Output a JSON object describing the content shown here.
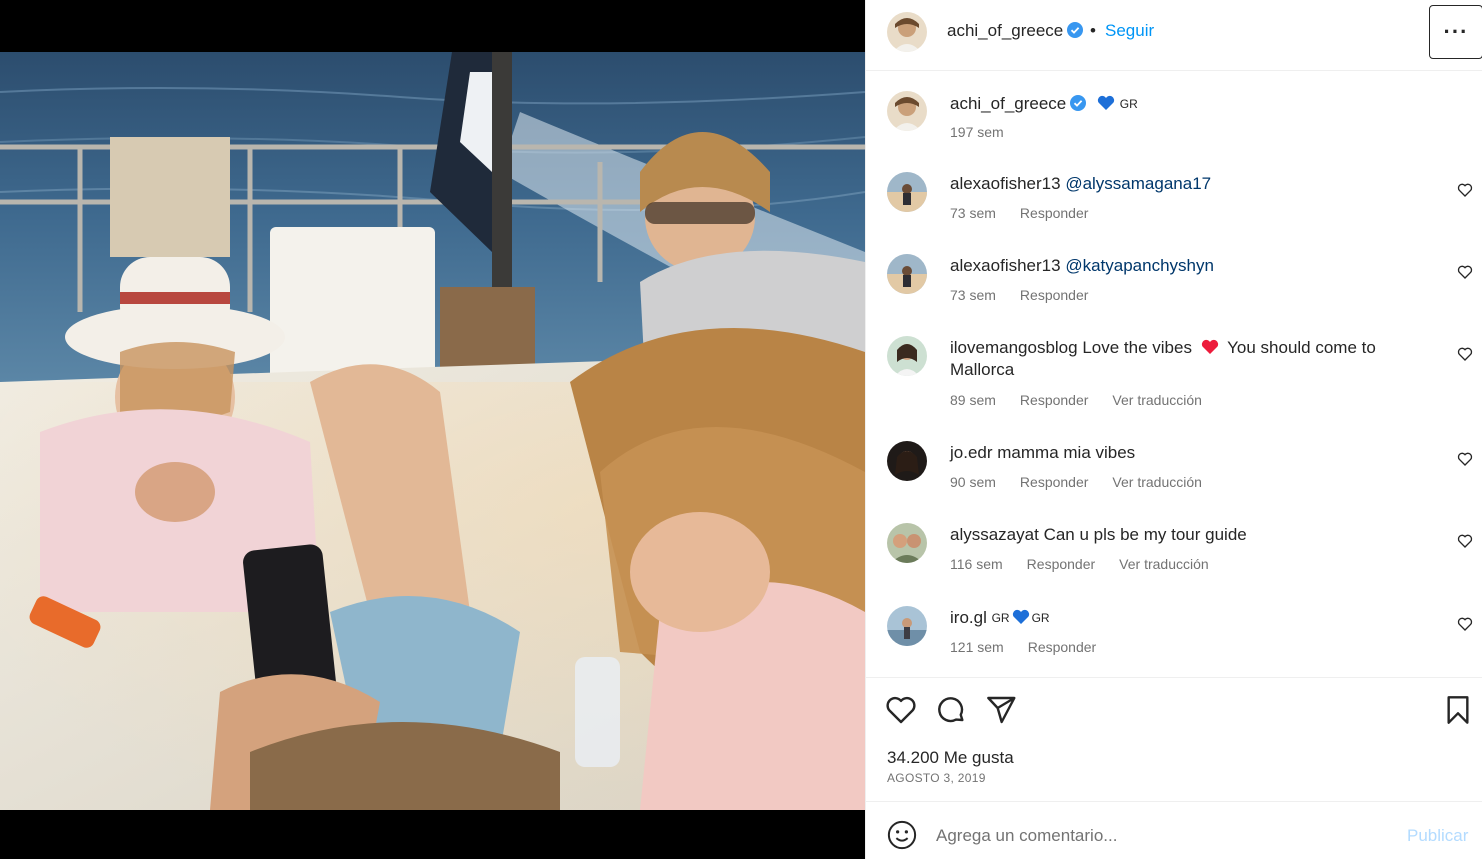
{
  "post": {
    "image_alt": "Group of friends relaxing on a boat deck at sunset",
    "author": "achi_of_greece",
    "follow_label": "Seguir",
    "separator": "•",
    "more_label": "···",
    "caption": {
      "user": "achi_of_greece",
      "text": "GR",
      "time": "197 sem"
    }
  },
  "comments": [
    {
      "user": "alexaofisher13",
      "mention": "@alyssamagana17",
      "text": "",
      "time": "73 sem",
      "reply": "Responder",
      "translate": ""
    },
    {
      "user": "alexaofisher13",
      "mention": "@katyapanchyshyn",
      "text": "",
      "time": "73 sem",
      "reply": "Responder",
      "translate": ""
    },
    {
      "user": "ilovemangosblog",
      "mention": "",
      "text_a": "Love the vibes",
      "text_b": "You should come to Mallorca",
      "time": "89 sem",
      "reply": "Responder",
      "translate": "Ver traducción"
    },
    {
      "user": "jo.edr",
      "mention": "",
      "text": "mamma mia vibes",
      "time": "90 sem",
      "reply": "Responder",
      "translate": "Ver traducción"
    },
    {
      "user": "alyssazayat",
      "mention": "",
      "text": "Can u pls be my tour guide",
      "time": "116 sem",
      "reply": "Responder",
      "translate": "Ver traducción"
    },
    {
      "user": "iro.gl",
      "mention": "",
      "text_a": "GR",
      "text_b": "GR",
      "time": "121 sem",
      "reply": "Responder",
      "translate": ""
    }
  ],
  "stats": {
    "likes": "34.200 Me gusta",
    "date": "AGOSTO 3, 2019"
  },
  "composer": {
    "placeholder": "Agrega un comentario...",
    "publish_label": "Publicar"
  },
  "colors": {
    "link": "#0095f6",
    "mention": "#00376b",
    "muted": "#737373",
    "heart_red": "#ed1c3c",
    "heart_blue": "#1d6fd8",
    "verified": "#3897f0"
  }
}
